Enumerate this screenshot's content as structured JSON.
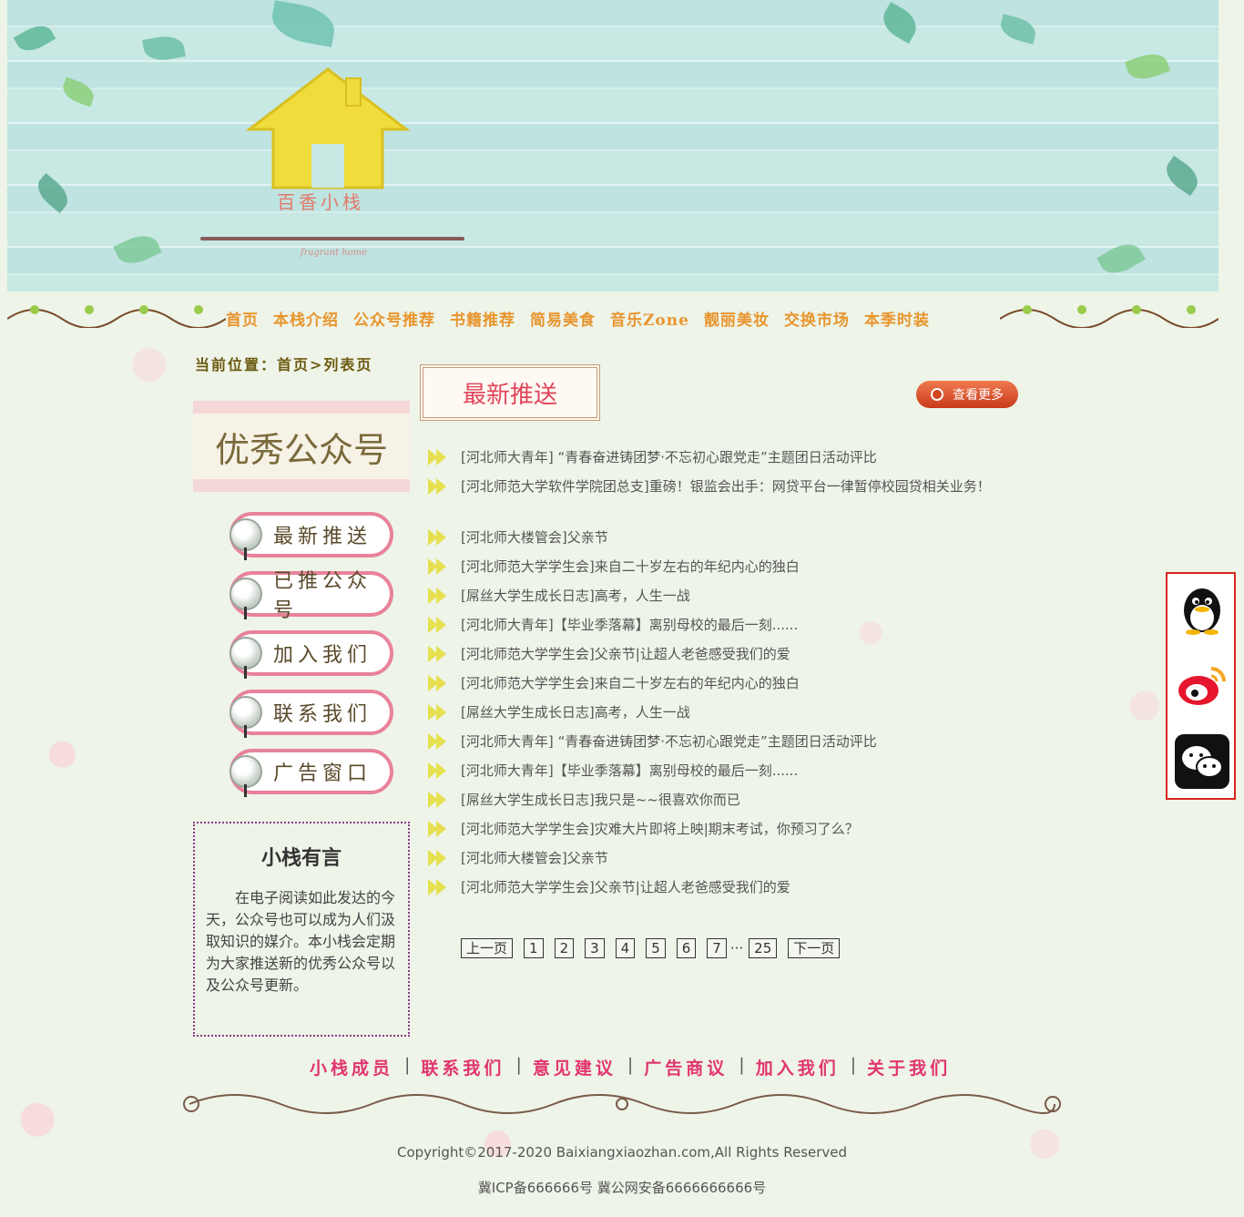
{
  "header": {
    "logo_title": "百香小栈",
    "logo_subtitle": "fragrant home"
  },
  "nav": {
    "items": [
      "首页",
      "本栈介绍",
      "公众号推荐",
      "书籍推荐",
      "简易美食",
      "音乐Zone",
      "靓丽美妆",
      "交换市场",
      "本季时装"
    ]
  },
  "breadcrumb": "当前位置：首页>列表页",
  "sidebar": {
    "banner": "优秀公众号",
    "buttons": [
      "最新推送",
      "已推公众号",
      "加入我们",
      "联系我们",
      "广告窗口"
    ],
    "saying_title": "小栈有言",
    "saying_text": "在电子阅读如此发达的今天，公众号也可以成为人们汲取知识的媒介。本小栈会定期为大家推送新的优秀公众号以及公众号更新。"
  },
  "main": {
    "section_title": "最新推送",
    "more_label": "查看更多",
    "articles": [
      "[河北师大青年] “青春奋进铸团梦·不忘初心跟党走”主题团日活动评比",
      "[河北师范大学软件学院团总支]重磅！银监会出手：网贷平台一律暂停校园贷相关业务！",
      "[河北师大楼管会]父亲节",
      "[河北师范大学学生会]来自二十岁左右的年纪内心的独白",
      "[屌丝大学生成长日志]高考，人生一战",
      "[河北师大青年]【毕业季落幕】离别母校的最后一刻......",
      "[河北师范大学学生会]父亲节|让超人老爸感受我们的爱",
      "[河北师范大学学生会]来自二十岁左右的年纪内心的独白",
      "[屌丝大学生成长日志]高考，人生一战",
      "[河北师大青年] “青春奋进铸团梦·不忘初心跟党走”主题团日活动评比",
      "[河北师大青年]【毕业季落幕】离别母校的最后一刻......",
      "[屌丝大学生成长日志]我只是~~很喜欢你而已",
      "[河北师范大学学生会]灾难大片即将上映|期末考试，你预习了么？",
      "[河北师大楼管会]父亲节",
      "[河北师范大学学生会]父亲节|让超人老爸感受我们的爱"
    ]
  },
  "pager": {
    "prev": "上一页",
    "pages": [
      "1",
      "2",
      "3",
      "4",
      "5",
      "6",
      "7"
    ],
    "ellipsis": "···",
    "last": "25",
    "next": "下一页"
  },
  "social": [
    "qq-icon",
    "weibo-icon",
    "wechat-icon"
  ],
  "footer": {
    "links": [
      "小栈成员",
      "联系我们",
      "意见建议",
      "广告商议",
      "加入我们",
      "关于我们"
    ],
    "copyright": "Copyright©2017-2020 Baixiangxiaozhan.com,All Rights Reserved",
    "icp": "冀ICP备666666号 冀公网安备6666666666号"
  }
}
